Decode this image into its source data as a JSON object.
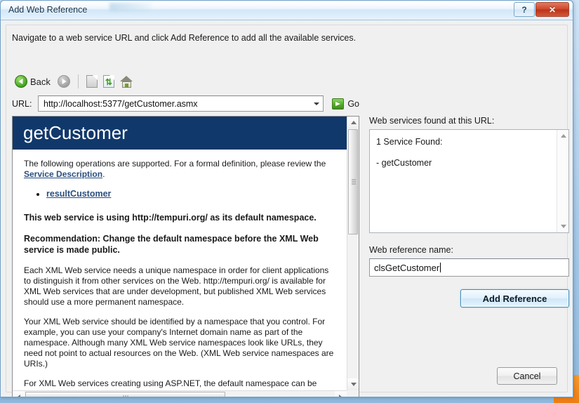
{
  "window": {
    "title": "Add Web Reference",
    "help_button": "?",
    "close_button": "✕"
  },
  "instruction": "Navigate to a web service URL and click Add Reference to add all the available services.",
  "toolbar": {
    "back_label": "Back",
    "forward_label": "",
    "stop_label": "",
    "refresh_label": "",
    "home_label": ""
  },
  "url_bar": {
    "label": "URL:",
    "value": "http://localhost:5377/getCustomer.asmx",
    "go_label": "Go"
  },
  "browser": {
    "service_title": "getCustomer",
    "intro_prefix": "The following operations are supported. For a formal definition, please review the ",
    "service_description_link": "Service Description",
    "intro_suffix": ".",
    "operations": [
      "resultCustomer"
    ],
    "bold_paragraph_1": "This web service is using http://tempuri.org/ as its default namespace.",
    "bold_paragraph_2": "Recommendation: Change the default namespace before the XML Web service is made public.",
    "paragraph_1": "Each XML Web service needs a unique namespace in order for client applications to distinguish it from other services on the Web. http://tempuri.org/ is available for XML Web services that are under development, but published XML Web services should use a more permanent namespace.",
    "paragraph_2": "Your XML Web service should be identified by a namespace that you control. For example, you can use your company's Internet domain name as part of the namespace. Although many XML Web service namespaces look like URLs, they need not point to actual resources on the Web. (XML Web service namespaces are URIs.)",
    "paragraph_3": "For XML Web services creating using ASP.NET, the default namespace can be"
  },
  "services_panel": {
    "label": "Web services found at this URL:",
    "count_text": "1 Service Found:",
    "items": [
      "- getCustomer"
    ]
  },
  "reference_name": {
    "label": "Web reference name:",
    "value": "clsGetCustomer"
  },
  "buttons": {
    "add_reference": "Add Reference",
    "cancel": "Cancel"
  },
  "colors": {
    "asmx_banner": "#10386b",
    "link": "#2a4f80",
    "accent_button_border": "#3c8dbc",
    "close_button": "#cf462a",
    "go_green": "#54ab2c"
  }
}
